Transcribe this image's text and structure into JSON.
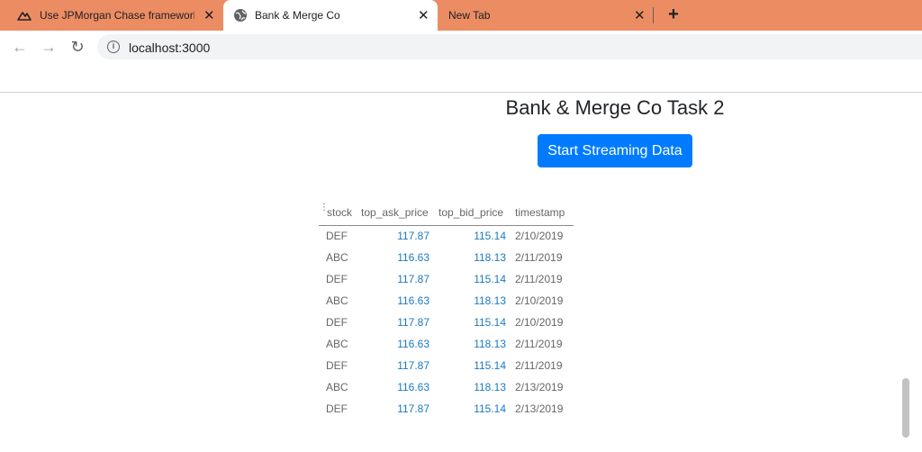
{
  "browser": {
    "tabs": [
      {
        "title": "Use JPMorgan Chase frameworks",
        "icon": "mountain-icon"
      },
      {
        "title": "Bank & Merge Co",
        "icon": "globe-icon"
      },
      {
        "title": "New Tab"
      }
    ],
    "url": "localhost:3000"
  },
  "page": {
    "title": "Bank & Merge Co Task 2",
    "button_label": "Start Streaming Data",
    "accent_color": "#007bff"
  },
  "grid": {
    "columns": [
      "stock",
      "top_ask_price",
      "top_bid_price",
      "timestamp"
    ],
    "rows": [
      {
        "stock": "DEF",
        "top_ask_price": "117.87",
        "top_bid_price": "115.14",
        "timestamp": "2/10/2019"
      },
      {
        "stock": "ABC",
        "top_ask_price": "116.63",
        "top_bid_price": "118.13",
        "timestamp": "2/11/2019"
      },
      {
        "stock": "DEF",
        "top_ask_price": "117.87",
        "top_bid_price": "115.14",
        "timestamp": "2/11/2019"
      },
      {
        "stock": "ABC",
        "top_ask_price": "116.63",
        "top_bid_price": "118.13",
        "timestamp": "2/10/2019"
      },
      {
        "stock": "DEF",
        "top_ask_price": "117.87",
        "top_bid_price": "115.14",
        "timestamp": "2/10/2019"
      },
      {
        "stock": "ABC",
        "top_ask_price": "116.63",
        "top_bid_price": "118.13",
        "timestamp": "2/11/2019"
      },
      {
        "stock": "DEF",
        "top_ask_price": "117.87",
        "top_bid_price": "115.14",
        "timestamp": "2/11/2019"
      },
      {
        "stock": "ABC",
        "top_ask_price": "116.63",
        "top_bid_price": "118.13",
        "timestamp": "2/13/2019"
      },
      {
        "stock": "DEF",
        "top_ask_price": "117.87",
        "top_bid_price": "115.14",
        "timestamp": "2/13/2019"
      }
    ]
  }
}
